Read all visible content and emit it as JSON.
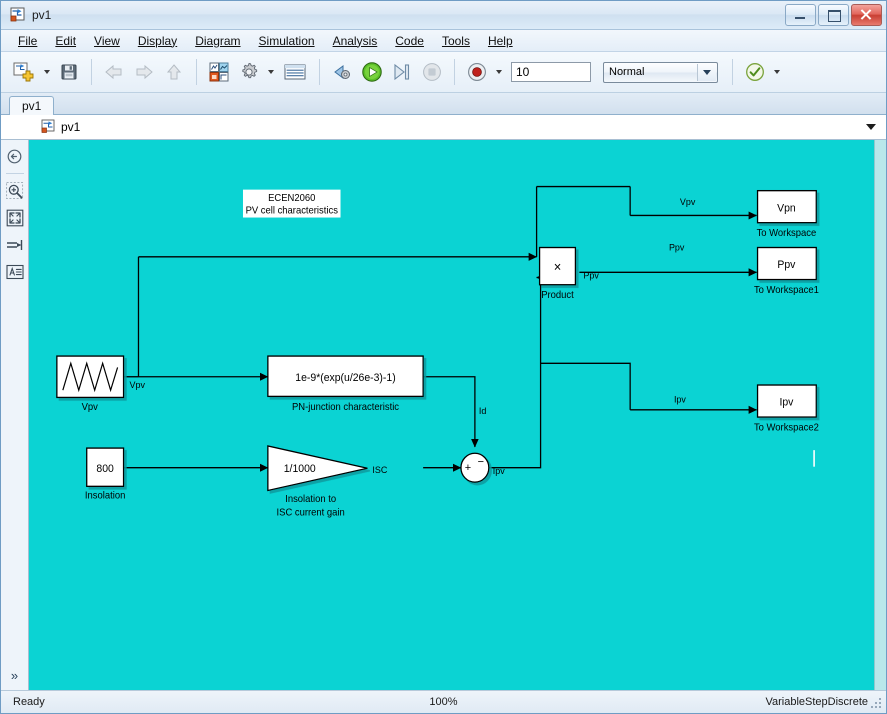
{
  "window": {
    "title": "pv1",
    "icon": "simulink-model-icon",
    "buttons": [
      {
        "name": "minimize-button",
        "icon": "minimize-icon"
      },
      {
        "name": "maximize-button",
        "icon": "maximize-icon"
      },
      {
        "name": "close-button",
        "icon": "close-icon"
      }
    ]
  },
  "menubar": {
    "items": [
      {
        "label": "File",
        "mnemonic": "F"
      },
      {
        "label": "Edit",
        "mnemonic": "E"
      },
      {
        "label": "View",
        "mnemonic": "V"
      },
      {
        "label": "Display",
        "mnemonic": "D"
      },
      {
        "label": "Diagram",
        "mnemonic": "D"
      },
      {
        "label": "Simulation",
        "mnemonic": "S"
      },
      {
        "label": "Analysis",
        "mnemonic": "A"
      },
      {
        "label": "Code",
        "mnemonic": "C"
      },
      {
        "label": "Tools",
        "mnemonic": "T"
      },
      {
        "label": "Help",
        "mnemonic": "H"
      }
    ]
  },
  "toolbar": {
    "new_model_icon": "new-model-icon",
    "save_icon": "save-icon",
    "back_icon": "back-arrow-icon",
    "forward_icon": "forward-arrow-icon",
    "up_icon": "up-arrow-icon",
    "library_browser_icon": "library-browser-icon",
    "model_configuration_icon": "model-configuration-gear-icon",
    "model_explorer_icon": "model-explorer-icon",
    "build_icon": "build-model-icon",
    "run_icon": "run-icon",
    "step_forward_icon": "step-forward-icon",
    "stop_icon": "stop-icon",
    "record_icon": "data-inspector-record-icon",
    "check_icon": "model-advisor-check-icon",
    "stop_time_value": "10",
    "simulation_mode": "Normal"
  },
  "tabs": [
    {
      "label": "pv1",
      "active": true
    }
  ],
  "breadcrumb": {
    "back_icon": "back-circle-icon",
    "model_icon": "simulink-model-icon",
    "path": "pv1",
    "dropdown_icon": "chevron-down-icon"
  },
  "palette": {
    "items": [
      {
        "name": "navigate-back-icon",
        "label": "back"
      },
      {
        "name": "zoom-icon",
        "label": "zoom"
      },
      {
        "name": "fit-to-view-icon",
        "label": "fit to view"
      },
      {
        "name": "signal-icon",
        "label": "signal"
      },
      {
        "name": "annotation-icon",
        "label": "annotation"
      }
    ],
    "expand_icon": "chevron-double-right-icon"
  },
  "statusbar": {
    "status": "Ready",
    "zoom": "100%",
    "solver": "VariableStepDiscrete",
    "grip_icon": "resize-grip-icon"
  },
  "canvas": {
    "background_color": "#0bd3d3",
    "annotation": {
      "line1": "ECEN2060",
      "line2": "PV cell characteristics"
    },
    "blocks": [
      {
        "id": "vpv_source",
        "type": "signal-generator",
        "text": "",
        "label": "Vpv"
      },
      {
        "id": "insolation",
        "type": "constant",
        "text": "800",
        "label": "Insolation"
      },
      {
        "id": "pn_junction",
        "type": "fcn",
        "text": "1e-9*(exp(u/26e-3)-1)",
        "label": "PN-junction characteristic"
      },
      {
        "id": "isc_gain",
        "type": "gain",
        "text": "1/1000",
        "label": "Insolation to\nISC current gain"
      },
      {
        "id": "sum",
        "type": "sum",
        "text": "+ −",
        "label": ""
      },
      {
        "id": "product",
        "type": "product",
        "text": "×",
        "label": "Product"
      },
      {
        "id": "to_ws_vpn",
        "type": "to-workspace",
        "text": "Vpn",
        "label": "To Workspace"
      },
      {
        "id": "to_ws_ppv",
        "type": "to-workspace",
        "text": "Ppv",
        "label": "To Workspace1"
      },
      {
        "id": "to_ws_ipv",
        "type": "to-workspace",
        "text": "Ipv",
        "label": "To Workspace2"
      }
    ],
    "signal_labels": [
      {
        "id": "sig_vpv_src",
        "text": "Vpv"
      },
      {
        "id": "sig_vpv_top",
        "text": "Vpv"
      },
      {
        "id": "sig_ppv_top",
        "text": "Ppv"
      },
      {
        "id": "sig_ppv_out",
        "text": "Ppv"
      },
      {
        "id": "sig_id",
        "text": "Id"
      },
      {
        "id": "sig_isc",
        "text": "ISC"
      },
      {
        "id": "sig_ipv_sum",
        "text": "Ipv"
      },
      {
        "id": "sig_ipv_out",
        "text": "Ipv"
      }
    ]
  }
}
